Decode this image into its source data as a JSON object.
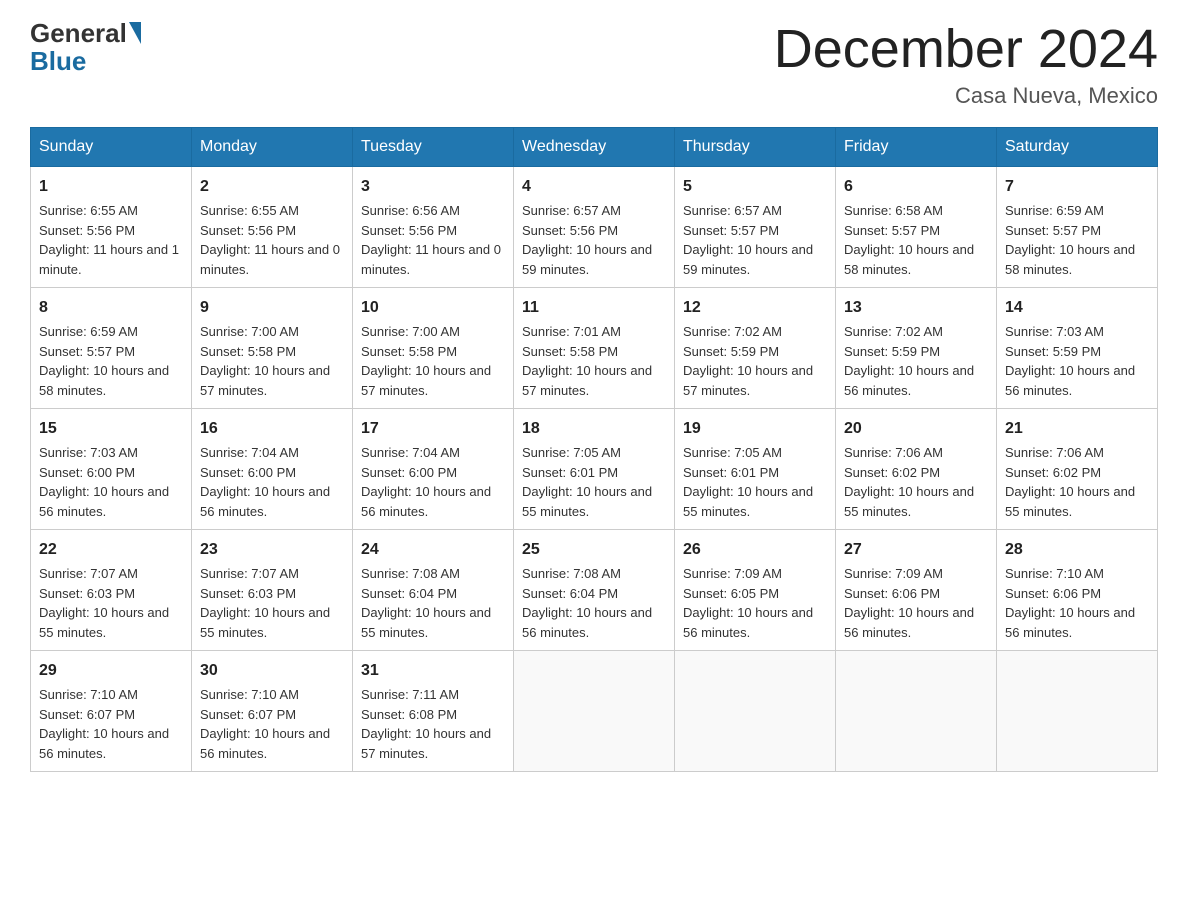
{
  "header": {
    "logo_general": "General",
    "logo_blue": "Blue",
    "title": "December 2024",
    "location": "Casa Nueva, Mexico"
  },
  "days_of_week": [
    "Sunday",
    "Monday",
    "Tuesday",
    "Wednesday",
    "Thursday",
    "Friday",
    "Saturday"
  ],
  "weeks": [
    [
      {
        "day": "1",
        "sunrise": "6:55 AM",
        "sunset": "5:56 PM",
        "daylight": "11 hours and 1 minute."
      },
      {
        "day": "2",
        "sunrise": "6:55 AM",
        "sunset": "5:56 PM",
        "daylight": "11 hours and 0 minutes."
      },
      {
        "day": "3",
        "sunrise": "6:56 AM",
        "sunset": "5:56 PM",
        "daylight": "11 hours and 0 minutes."
      },
      {
        "day": "4",
        "sunrise": "6:57 AM",
        "sunset": "5:56 PM",
        "daylight": "10 hours and 59 minutes."
      },
      {
        "day": "5",
        "sunrise": "6:57 AM",
        "sunset": "5:57 PM",
        "daylight": "10 hours and 59 minutes."
      },
      {
        "day": "6",
        "sunrise": "6:58 AM",
        "sunset": "5:57 PM",
        "daylight": "10 hours and 58 minutes."
      },
      {
        "day": "7",
        "sunrise": "6:59 AM",
        "sunset": "5:57 PM",
        "daylight": "10 hours and 58 minutes."
      }
    ],
    [
      {
        "day": "8",
        "sunrise": "6:59 AM",
        "sunset": "5:57 PM",
        "daylight": "10 hours and 58 minutes."
      },
      {
        "day": "9",
        "sunrise": "7:00 AM",
        "sunset": "5:58 PM",
        "daylight": "10 hours and 57 minutes."
      },
      {
        "day": "10",
        "sunrise": "7:00 AM",
        "sunset": "5:58 PM",
        "daylight": "10 hours and 57 minutes."
      },
      {
        "day": "11",
        "sunrise": "7:01 AM",
        "sunset": "5:58 PM",
        "daylight": "10 hours and 57 minutes."
      },
      {
        "day": "12",
        "sunrise": "7:02 AM",
        "sunset": "5:59 PM",
        "daylight": "10 hours and 57 minutes."
      },
      {
        "day": "13",
        "sunrise": "7:02 AM",
        "sunset": "5:59 PM",
        "daylight": "10 hours and 56 minutes."
      },
      {
        "day": "14",
        "sunrise": "7:03 AM",
        "sunset": "5:59 PM",
        "daylight": "10 hours and 56 minutes."
      }
    ],
    [
      {
        "day": "15",
        "sunrise": "7:03 AM",
        "sunset": "6:00 PM",
        "daylight": "10 hours and 56 minutes."
      },
      {
        "day": "16",
        "sunrise": "7:04 AM",
        "sunset": "6:00 PM",
        "daylight": "10 hours and 56 minutes."
      },
      {
        "day": "17",
        "sunrise": "7:04 AM",
        "sunset": "6:00 PM",
        "daylight": "10 hours and 56 minutes."
      },
      {
        "day": "18",
        "sunrise": "7:05 AM",
        "sunset": "6:01 PM",
        "daylight": "10 hours and 55 minutes."
      },
      {
        "day": "19",
        "sunrise": "7:05 AM",
        "sunset": "6:01 PM",
        "daylight": "10 hours and 55 minutes."
      },
      {
        "day": "20",
        "sunrise": "7:06 AM",
        "sunset": "6:02 PM",
        "daylight": "10 hours and 55 minutes."
      },
      {
        "day": "21",
        "sunrise": "7:06 AM",
        "sunset": "6:02 PM",
        "daylight": "10 hours and 55 minutes."
      }
    ],
    [
      {
        "day": "22",
        "sunrise": "7:07 AM",
        "sunset": "6:03 PM",
        "daylight": "10 hours and 55 minutes."
      },
      {
        "day": "23",
        "sunrise": "7:07 AM",
        "sunset": "6:03 PM",
        "daylight": "10 hours and 55 minutes."
      },
      {
        "day": "24",
        "sunrise": "7:08 AM",
        "sunset": "6:04 PM",
        "daylight": "10 hours and 55 minutes."
      },
      {
        "day": "25",
        "sunrise": "7:08 AM",
        "sunset": "6:04 PM",
        "daylight": "10 hours and 56 minutes."
      },
      {
        "day": "26",
        "sunrise": "7:09 AM",
        "sunset": "6:05 PM",
        "daylight": "10 hours and 56 minutes."
      },
      {
        "day": "27",
        "sunrise": "7:09 AM",
        "sunset": "6:06 PM",
        "daylight": "10 hours and 56 minutes."
      },
      {
        "day": "28",
        "sunrise": "7:10 AM",
        "sunset": "6:06 PM",
        "daylight": "10 hours and 56 minutes."
      }
    ],
    [
      {
        "day": "29",
        "sunrise": "7:10 AM",
        "sunset": "6:07 PM",
        "daylight": "10 hours and 56 minutes."
      },
      {
        "day": "30",
        "sunrise": "7:10 AM",
        "sunset": "6:07 PM",
        "daylight": "10 hours and 56 minutes."
      },
      {
        "day": "31",
        "sunrise": "7:11 AM",
        "sunset": "6:08 PM",
        "daylight": "10 hours and 57 minutes."
      },
      null,
      null,
      null,
      null
    ]
  ],
  "labels": {
    "sunrise": "Sunrise:",
    "sunset": "Sunset:",
    "daylight": "Daylight:"
  }
}
